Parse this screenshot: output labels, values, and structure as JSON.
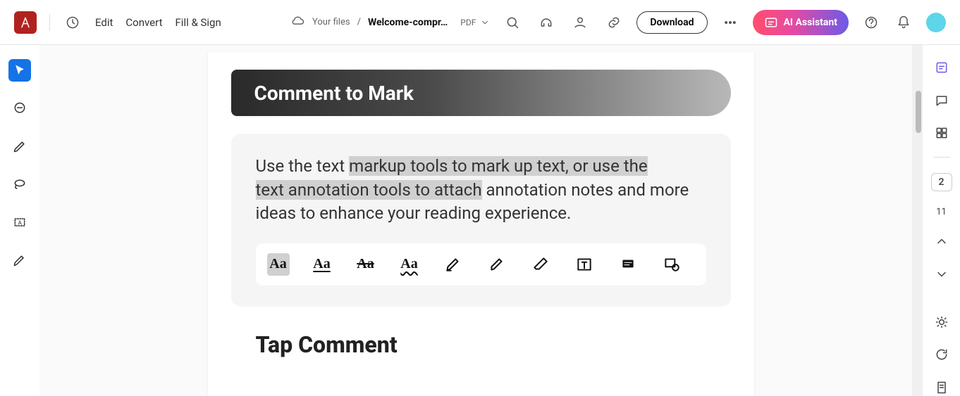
{
  "header": {
    "menu": {
      "edit": "Edit",
      "convert": "Convert",
      "fill_sign": "Fill & Sign"
    },
    "breadcrumb": {
      "root": "Your files",
      "sep": "/",
      "file": "Welcome-compr…"
    },
    "filetype": "PDF",
    "download": "Download",
    "ai_assistant": "AI Assistant"
  },
  "left_tools": [
    "select",
    "comment",
    "draw",
    "lasso",
    "text-select",
    "pen"
  ],
  "document": {
    "banner_title": "Comment to Mark",
    "body_pre": "Use the text ",
    "body_hl1": "markup tools to mark up text, or use the",
    "body_hl2": "text annotation tools to attach",
    "body_post": " annotation notes and more ideas to enhance your reading experience.",
    "markup_tools": [
      "highlight-aa",
      "underline-aa",
      "strike-aa",
      "squiggle-aa",
      "highlighter",
      "marker",
      "eraser",
      "textbox",
      "note",
      "stamp"
    ],
    "section2_title": "Tap Comment"
  },
  "right_rail": {
    "current_page": "2",
    "total_pages": "11"
  }
}
